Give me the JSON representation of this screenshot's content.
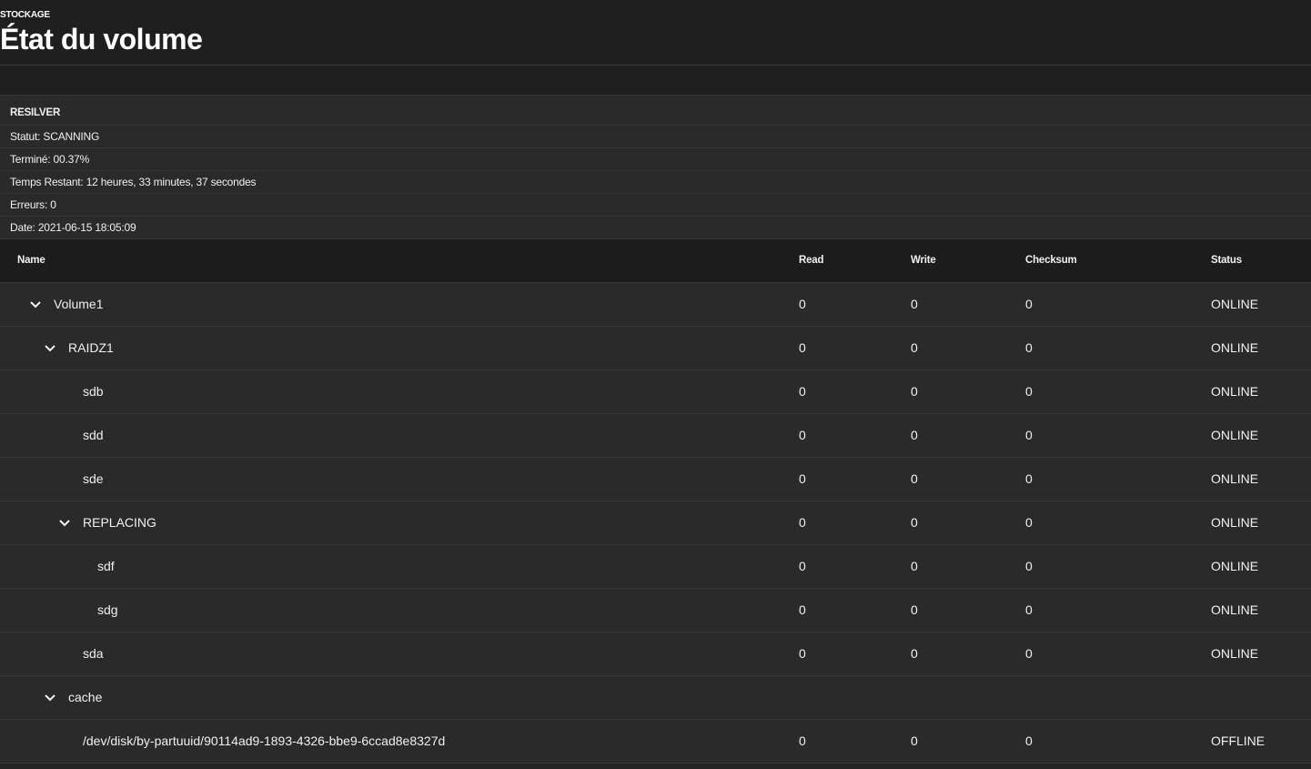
{
  "header": {
    "breadcrumb": "STOCKAGE",
    "title": "État du volume"
  },
  "resilver": {
    "title": "RESILVER",
    "status": "Statut: SCANNING",
    "completed": "Terminé: 00.37%",
    "remaining": "Temps Restant:  12 heures,  33 minutes,  37 secondes",
    "errors": "Erreurs: 0",
    "date": "Date: 2021-06-15 18:05:09"
  },
  "table": {
    "columns": {
      "name": "Name",
      "read": "Read",
      "write": "Write",
      "checksum": "Checksum",
      "status": "Status"
    },
    "rows": [
      {
        "name": "Volume1",
        "read": "0",
        "write": "0",
        "checksum": "0",
        "status": "ONLINE"
      },
      {
        "name": "RAIDZ1",
        "read": "0",
        "write": "0",
        "checksum": "0",
        "status": "ONLINE"
      },
      {
        "name": "sdb",
        "read": "0",
        "write": "0",
        "checksum": "0",
        "status": "ONLINE"
      },
      {
        "name": "sdd",
        "read": "0",
        "write": "0",
        "checksum": "0",
        "status": "ONLINE"
      },
      {
        "name": "sde",
        "read": "0",
        "write": "0",
        "checksum": "0",
        "status": "ONLINE"
      },
      {
        "name": "REPLACING",
        "read": "0",
        "write": "0",
        "checksum": "0",
        "status": "ONLINE"
      },
      {
        "name": "sdf",
        "read": "0",
        "write": "0",
        "checksum": "0",
        "status": "ONLINE"
      },
      {
        "name": "sdg",
        "read": "0",
        "write": "0",
        "checksum": "0",
        "status": "ONLINE"
      },
      {
        "name": "sda",
        "read": "0",
        "write": "0",
        "checksum": "0",
        "status": "ONLINE"
      },
      {
        "name": "cache",
        "read": "",
        "write": "",
        "checksum": "",
        "status": ""
      },
      {
        "name": "/dev/disk/by-partuuid/90114ad9-1893-4326-bbe9-6ccad8e8327d",
        "read": "0",
        "write": "0",
        "checksum": "0",
        "status": "OFFLINE"
      }
    ]
  },
  "icons": {
    "expand": "chevron-down-icon"
  },
  "colors": {
    "background": "#242424",
    "header_background": "#1c1c1c",
    "text": "#f0f0f0"
  }
}
